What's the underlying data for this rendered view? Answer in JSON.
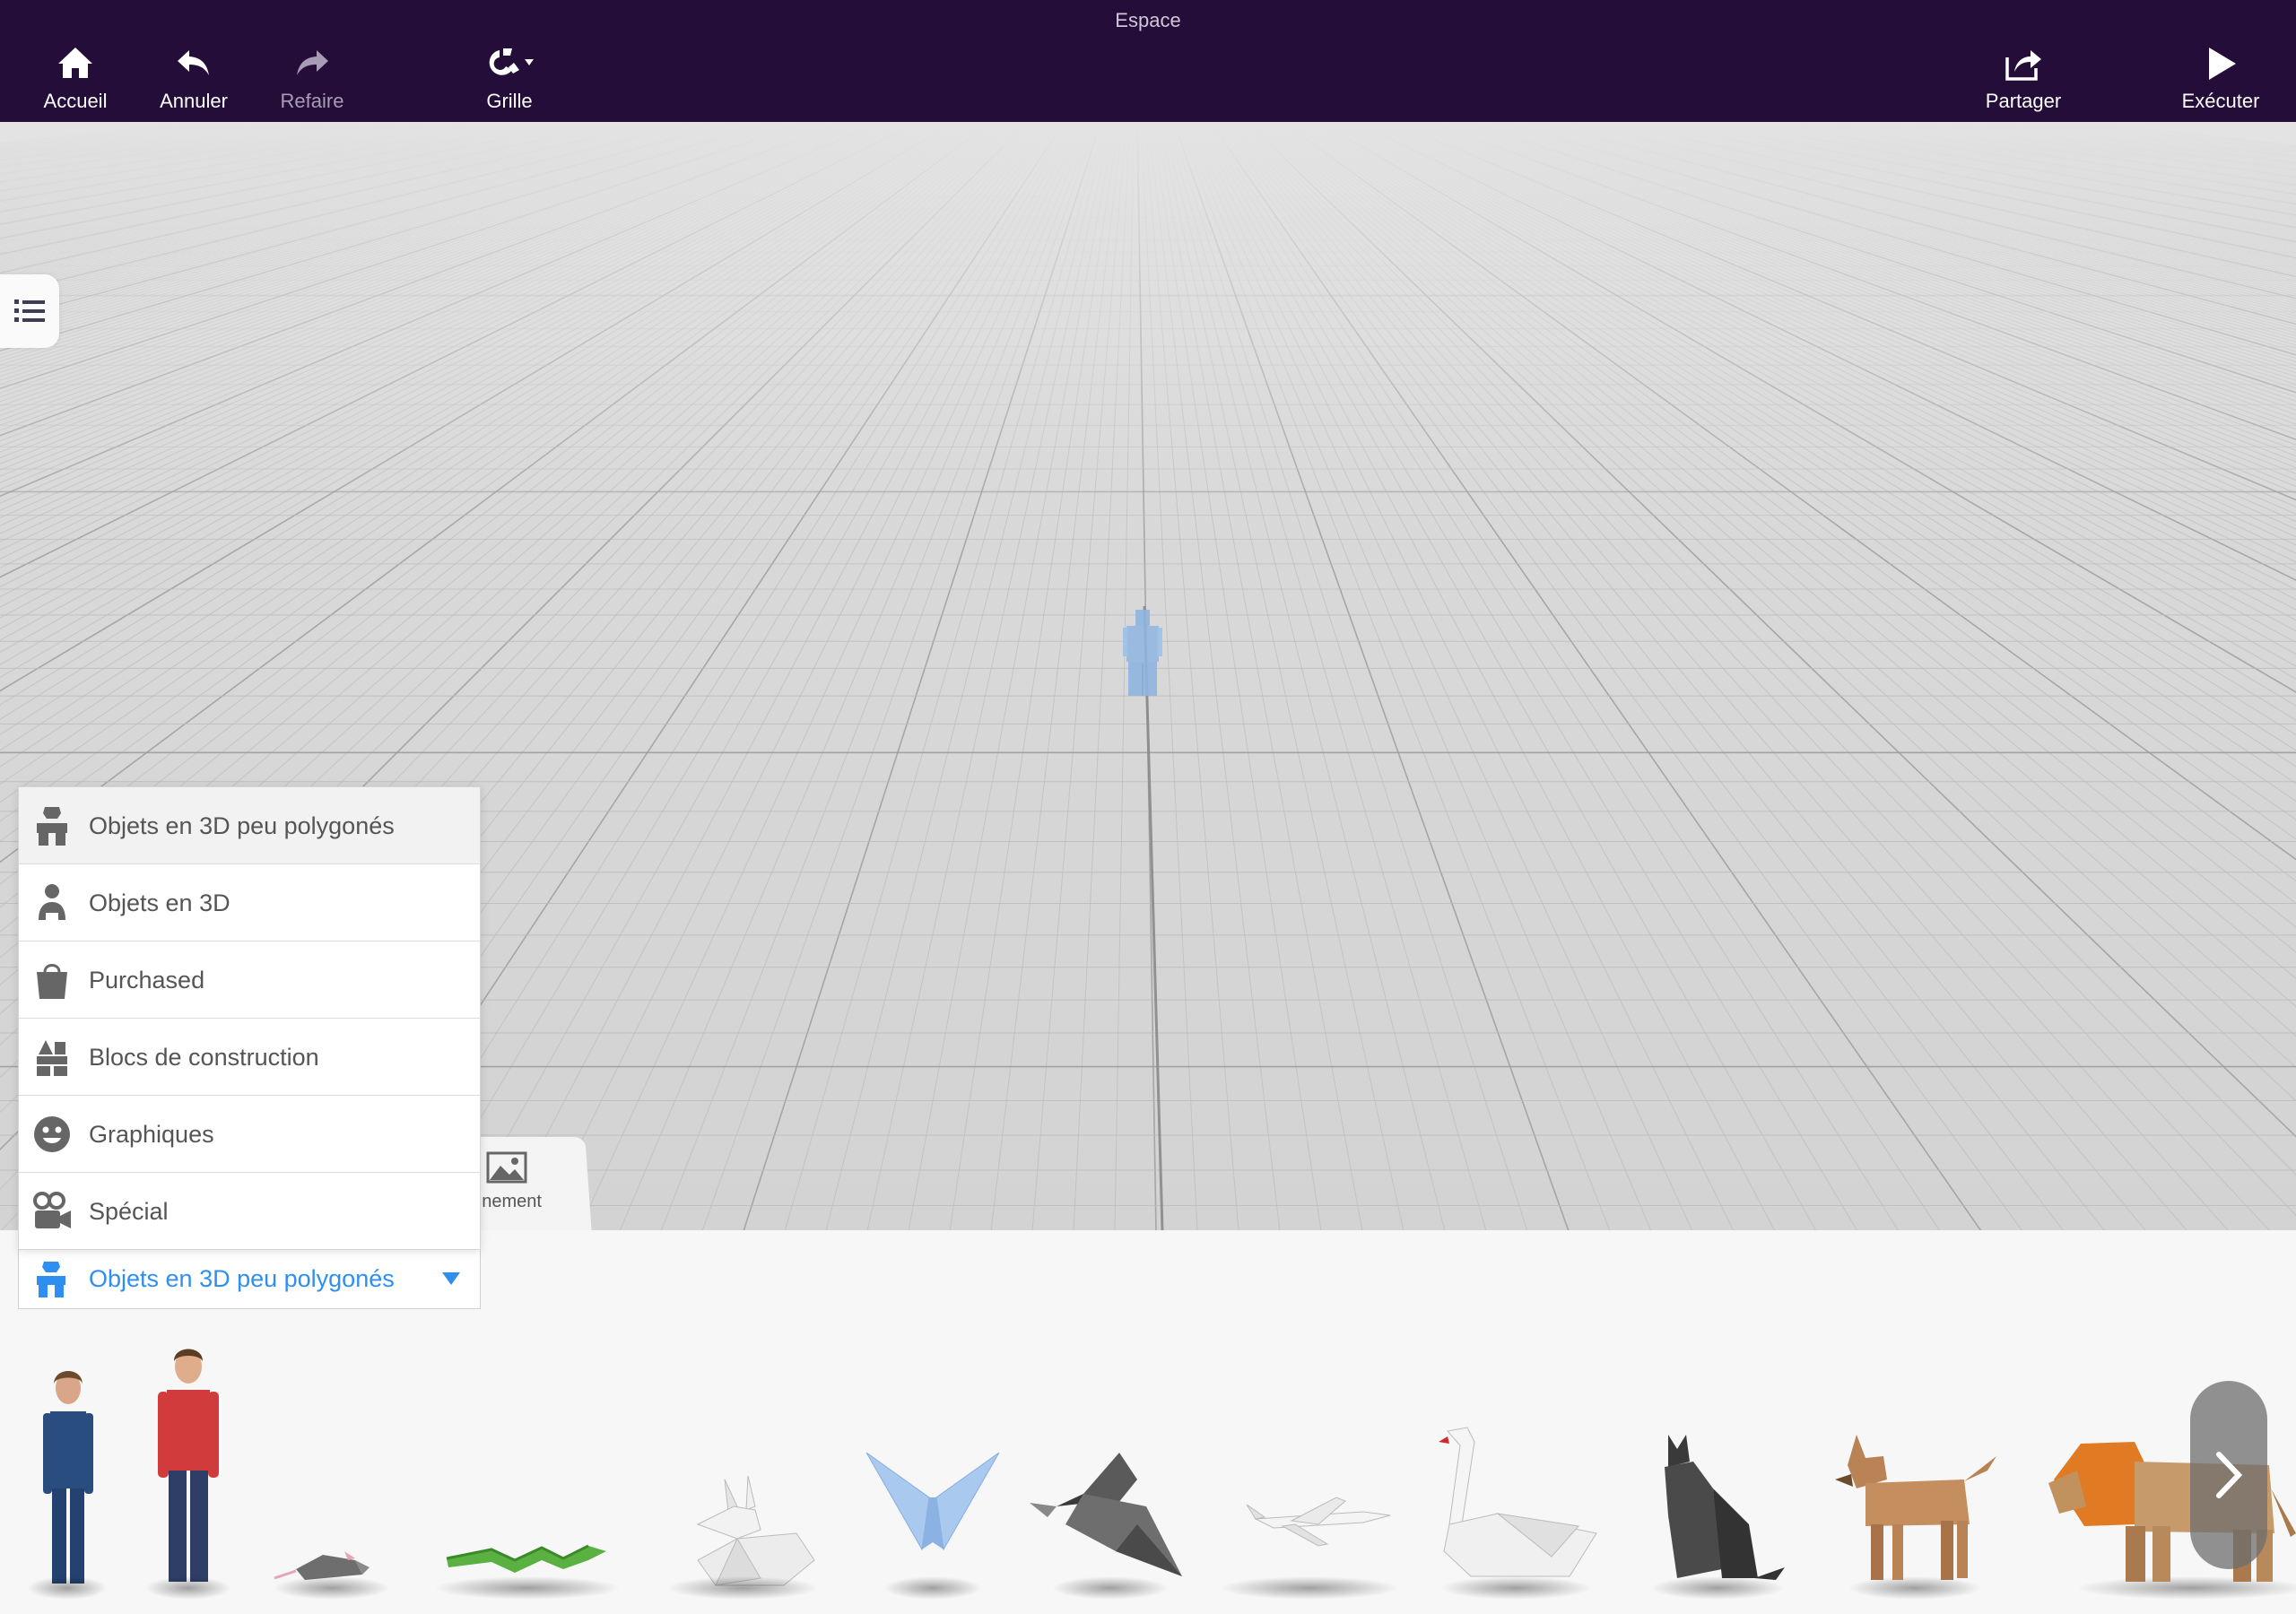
{
  "window": {
    "title": "Espace"
  },
  "toolbar": {
    "home_label": "Accueil",
    "undo_label": "Annuler",
    "redo_label": "Refaire",
    "grid_label": "Grille",
    "share_label": "Partager",
    "run_label": "Exécuter"
  },
  "colors": {
    "topbar": "#250d39",
    "accent": "#2f8ff0",
    "selected_object": "#8fb5e0"
  },
  "library": {
    "partial_tab_label": "nnement",
    "category_menu": [
      {
        "label": "Objets en 3D peu polygonés",
        "icon": "lowpoly-person-icon"
      },
      {
        "label": "Objets en 3D",
        "icon": "person-icon"
      },
      {
        "label": "Purchased",
        "icon": "shopping-bag-icon"
      },
      {
        "label": "Blocs de construction",
        "icon": "building-blocks-icon"
      },
      {
        "label": "Graphiques",
        "icon": "smiley-icon"
      },
      {
        "label": "Spécial",
        "icon": "movie-camera-icon"
      }
    ],
    "selected_category": "Objets en 3D peu polygonés",
    "assets": [
      "woman",
      "man",
      "mouse",
      "snake",
      "rabbit",
      "butterfly",
      "bird",
      "airplane",
      "swan",
      "cat",
      "dog",
      "lion"
    ]
  }
}
